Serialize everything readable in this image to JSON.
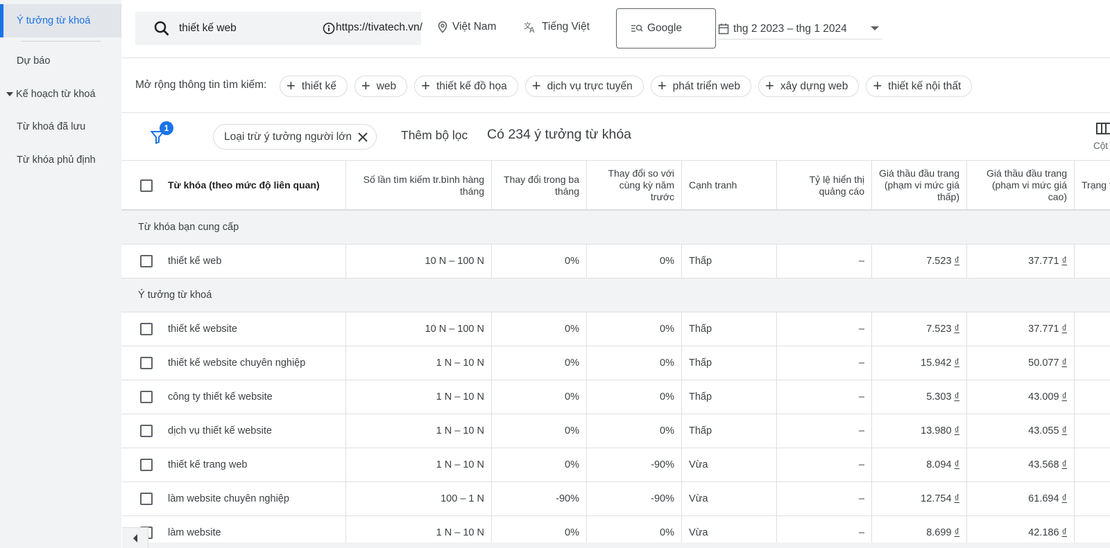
{
  "sidebar": {
    "items": [
      {
        "label": "Ý tưởng từ khoá"
      },
      {
        "label": "Dự báo"
      },
      {
        "label": "Kế hoạch từ khoá"
      },
      {
        "label": "Từ khoá đã lưu"
      },
      {
        "label": "Từ khóa phủ định"
      }
    ]
  },
  "topbar": {
    "keyword": "thiết kế web",
    "url": "https://tivatech.vn/",
    "location": "Việt Nam",
    "language": "Tiếng Việt",
    "engine": "Google",
    "date_range": "thg 2 2023 – thg 1 2024"
  },
  "refine": {
    "label": "Mở rộng thông tin tìm kiếm:",
    "chips": [
      "thiết kế",
      "web",
      "thiết kế đồ họa",
      "dịch vụ trực tuyến",
      "phát triển web",
      "xây dựng web",
      "thiết kế nội thất"
    ]
  },
  "filterbar": {
    "badge": "1",
    "filter_chip": "Loại trừ ý tưởng người lớn",
    "add_filter": "Thêm bộ lọc",
    "idea_count": "Có 234 ý tưởng từ khóa",
    "columns_label": "Cột"
  },
  "table": {
    "headers": {
      "keyword": "Từ khóa (theo mức độ liên quan)",
      "avg_searches": "Số lần tìm kiếm tr.bình hàng tháng",
      "three_month": "Thay đổi trong ba tháng",
      "yoy": "Thay đổi so với cùng kỳ năm trước",
      "competition": "Cạnh tranh",
      "impression_share": "Tỷ lệ hiển thị quảng cáo",
      "bid_low": "Giá thầu đầu trang (phạm vi mức giá thấp)",
      "bid_high": "Giá thầu đầu trang (phạm vi mức giá cao)",
      "status": "Trạng t"
    },
    "sections": {
      "provided": "Từ khóa bạn cung cấp",
      "ideas": "Ý tưởng từ khoá"
    },
    "provided_rows": [
      {
        "keyword": "thiết kế web",
        "avg": "10 N – 100 N",
        "three": "0%",
        "yoy": "0%",
        "comp": "Thấp",
        "share": "–",
        "low": "7.523",
        "high": "37.771"
      }
    ],
    "idea_rows": [
      {
        "keyword": "thiết kế website",
        "avg": "10 N – 100 N",
        "three": "0%",
        "yoy": "0%",
        "comp": "Thấp",
        "share": "–",
        "low": "7.523",
        "high": "37.771"
      },
      {
        "keyword": "thiết kế website chuyên nghiệp",
        "avg": "1 N – 10 N",
        "three": "0%",
        "yoy": "0%",
        "comp": "Thấp",
        "share": "–",
        "low": "15.942",
        "high": "50.077"
      },
      {
        "keyword": "công ty thiết kế website",
        "avg": "1 N – 10 N",
        "three": "0%",
        "yoy": "0%",
        "comp": "Thấp",
        "share": "–",
        "low": "5.303",
        "high": "43.009"
      },
      {
        "keyword": "dịch vụ thiết kế website",
        "avg": "1 N – 10 N",
        "three": "0%",
        "yoy": "0%",
        "comp": "Thấp",
        "share": "–",
        "low": "13.980",
        "high": "43.055"
      },
      {
        "keyword": "thiết kế trang web",
        "avg": "1 N – 10 N",
        "three": "0%",
        "yoy": "-90%",
        "comp": "Vừa",
        "share": "–",
        "low": "8.094",
        "high": "43.568"
      },
      {
        "keyword": "làm website chuyên nghiệp",
        "avg": "100 – 1 N",
        "three": "-90%",
        "yoy": "-90%",
        "comp": "Vừa",
        "share": "–",
        "low": "12.754",
        "high": "61.694"
      },
      {
        "keyword": "làm website",
        "avg": "1 N – 10 N",
        "three": "0%",
        "yoy": "0%",
        "comp": "Vừa",
        "share": "–",
        "low": "8.699",
        "high": "42.186"
      }
    ],
    "currency_symbol": "₫"
  },
  "colors": {
    "accent": "#1a73e8",
    "sidebar_bg": "#f1f3f4"
  }
}
